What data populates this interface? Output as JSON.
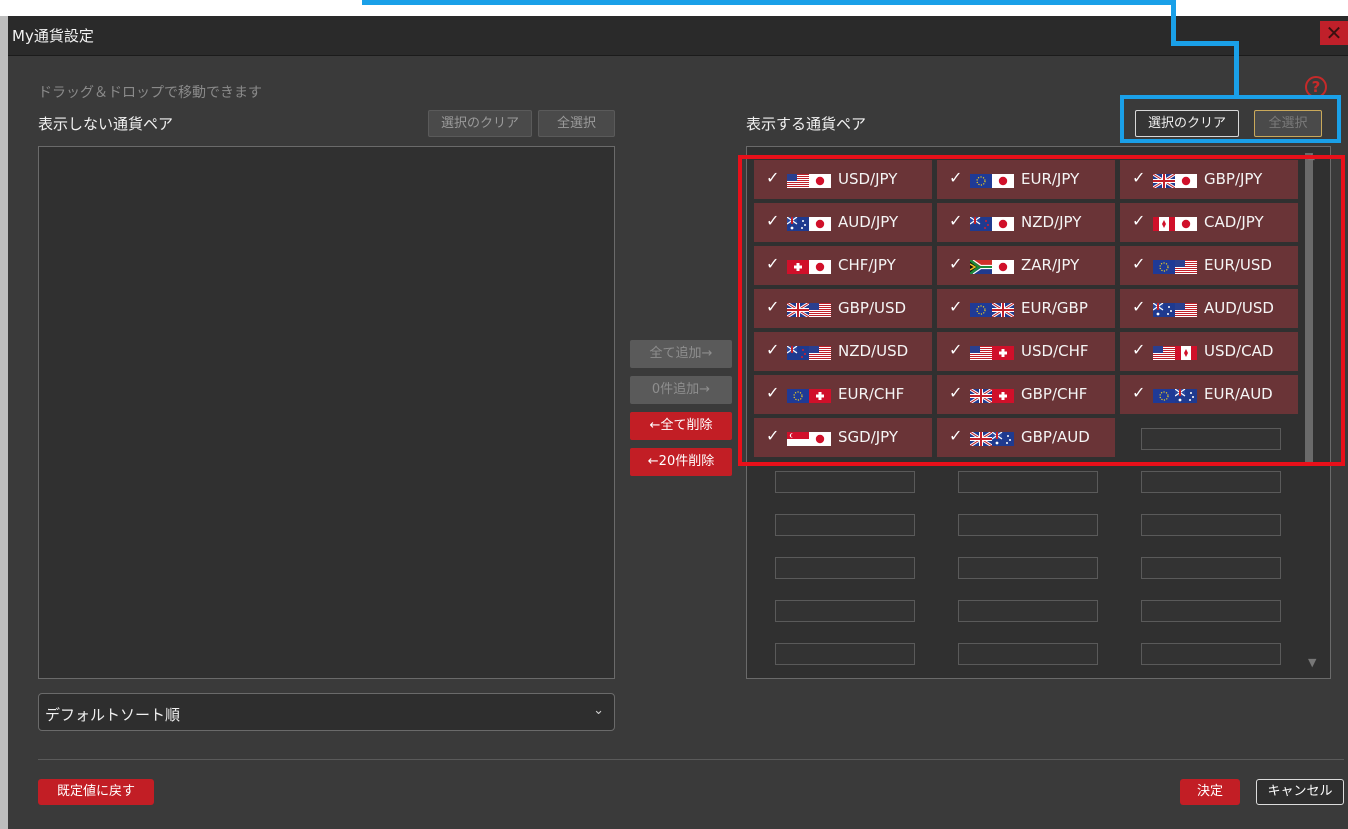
{
  "window": {
    "title": "My通貨設定",
    "close_label": "✕"
  },
  "hint": "ドラッグ＆ドロップで移動できます",
  "help_label": "?",
  "hidden_pairs": {
    "label": "表示しない通貨ペア",
    "clear_label": "選択のクリア",
    "select_all_label": "全選択"
  },
  "shown_pairs": {
    "label": "表示する通貨ペア",
    "clear_label": "選択のクリア",
    "select_all_label": "全選択",
    "items": [
      {
        "code": "USD/JPY",
        "checked": true,
        "flags": [
          "us",
          "jp"
        ]
      },
      {
        "code": "EUR/JPY",
        "checked": true,
        "flags": [
          "eu",
          "jp"
        ]
      },
      {
        "code": "GBP/JPY",
        "checked": true,
        "flags": [
          "gb",
          "jp"
        ]
      },
      {
        "code": "AUD/JPY",
        "checked": true,
        "flags": [
          "au",
          "jp"
        ]
      },
      {
        "code": "NZD/JPY",
        "checked": true,
        "flags": [
          "nz",
          "jp"
        ]
      },
      {
        "code": "CAD/JPY",
        "checked": true,
        "flags": [
          "ca",
          "jp"
        ]
      },
      {
        "code": "CHF/JPY",
        "checked": true,
        "flags": [
          "ch",
          "jp"
        ]
      },
      {
        "code": "ZAR/JPY",
        "checked": true,
        "flags": [
          "za",
          "jp"
        ]
      },
      {
        "code": "EUR/USD",
        "checked": true,
        "flags": [
          "eu",
          "us"
        ]
      },
      {
        "code": "GBP/USD",
        "checked": true,
        "flags": [
          "gb",
          "us"
        ]
      },
      {
        "code": "EUR/GBP",
        "checked": true,
        "flags": [
          "eu",
          "gb"
        ]
      },
      {
        "code": "AUD/USD",
        "checked": true,
        "flags": [
          "au",
          "us"
        ]
      },
      {
        "code": "NZD/USD",
        "checked": true,
        "flags": [
          "nz",
          "us"
        ]
      },
      {
        "code": "USD/CHF",
        "checked": true,
        "flags": [
          "us",
          "ch"
        ]
      },
      {
        "code": "USD/CAD",
        "checked": true,
        "flags": [
          "us",
          "ca"
        ]
      },
      {
        "code": "EUR/CHF",
        "checked": true,
        "flags": [
          "eu",
          "ch"
        ]
      },
      {
        "code": "GBP/CHF",
        "checked": true,
        "flags": [
          "gb",
          "ch"
        ]
      },
      {
        "code": "EUR/AUD",
        "checked": true,
        "flags": [
          "eu",
          "au"
        ]
      },
      {
        "code": "SGD/JPY",
        "checked": true,
        "flags": [
          "sg",
          "jp"
        ]
      },
      {
        "code": "GBP/AUD",
        "checked": true,
        "flags": [
          "gb",
          "au"
        ]
      }
    ]
  },
  "transfer": {
    "add_all_label": "全て追加→",
    "add_selected_label": "0件追加→",
    "remove_all_label": "←全て削除",
    "remove_selected_label": "←20件削除"
  },
  "sort": {
    "selected": "デフォルトソート順"
  },
  "footer": {
    "reset_label": "既定値に戻す",
    "ok_label": "決定",
    "cancel_label": "キャンセル"
  },
  "colors": {
    "accent_red": "#c21e25",
    "annotation_blue": "#1aa0e8",
    "annotation_red": "#e8101a",
    "selected_row": "#6a3437"
  }
}
